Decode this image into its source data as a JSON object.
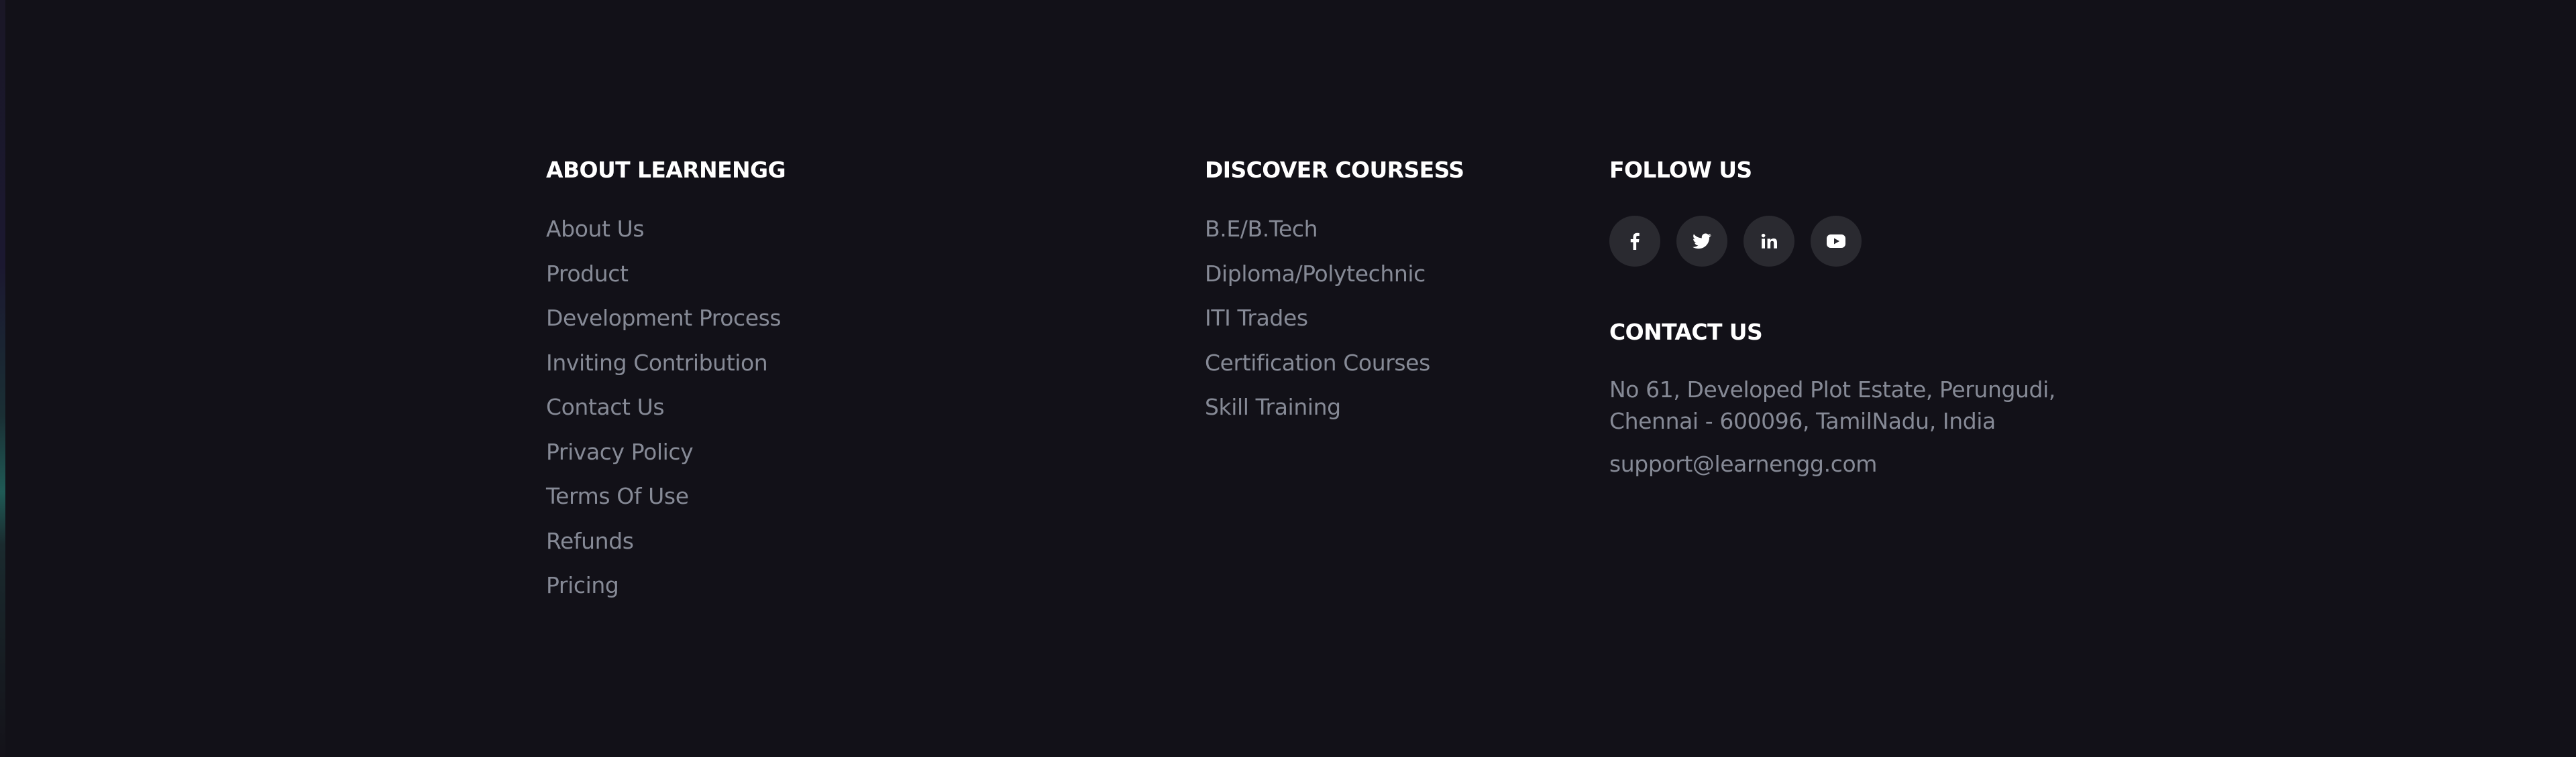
{
  "about": {
    "heading": "ABOUT LEARNENGG",
    "links": [
      "About Us",
      "Product",
      "Development Process",
      "Inviting Contribution",
      "Contact Us",
      "Privacy Policy",
      "Terms Of Use",
      "Refunds",
      "Pricing"
    ]
  },
  "discover": {
    "heading": "DISCOVER COURSESS",
    "links": [
      "B.E/B.Tech",
      "Diploma/Polytechnic",
      "ITI Trades",
      "Certification Courses",
      "Skill Training"
    ]
  },
  "follow": {
    "heading": "FOLLOW US",
    "icons": [
      "facebook-icon",
      "twitter-icon",
      "linkedin-icon",
      "youtube-icon"
    ]
  },
  "contact": {
    "heading": "CONTACT US",
    "address_line1": "No 61, Developed Plot Estate, Perungudi,",
    "address_line2": "Chennai - 600096, TamilNadu, India",
    "email": "support@learnengg.com"
  },
  "colors": {
    "background": "#121118",
    "heading": "#ffffff",
    "link": "#868a96",
    "social_button": "#2a2a30"
  }
}
